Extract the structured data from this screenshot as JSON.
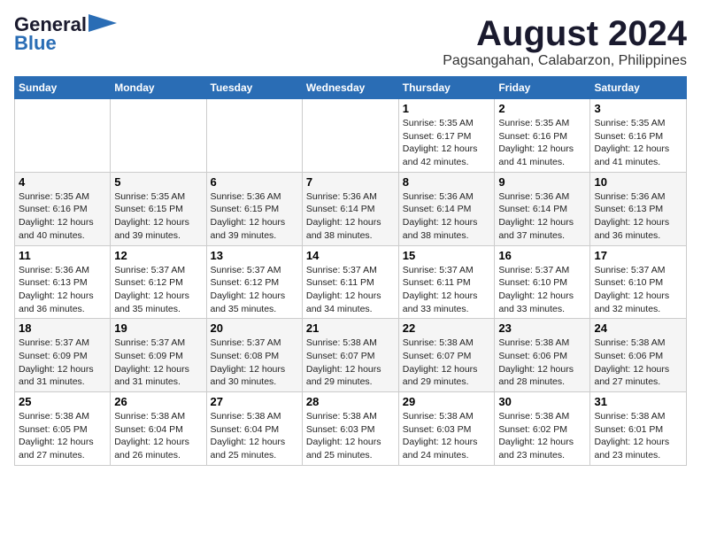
{
  "header": {
    "logo_line1": "General",
    "logo_line2": "Blue",
    "title": "August 2024",
    "subtitle": "Pagsangahan, Calabarzon, Philippines"
  },
  "weekdays": [
    "Sunday",
    "Monday",
    "Tuesday",
    "Wednesday",
    "Thursday",
    "Friday",
    "Saturday"
  ],
  "weeks": [
    [
      {
        "day": "",
        "info": ""
      },
      {
        "day": "",
        "info": ""
      },
      {
        "day": "",
        "info": ""
      },
      {
        "day": "",
        "info": ""
      },
      {
        "day": "1",
        "info": "Sunrise: 5:35 AM\nSunset: 6:17 PM\nDaylight: 12 hours\nand 42 minutes."
      },
      {
        "day": "2",
        "info": "Sunrise: 5:35 AM\nSunset: 6:16 PM\nDaylight: 12 hours\nand 41 minutes."
      },
      {
        "day": "3",
        "info": "Sunrise: 5:35 AM\nSunset: 6:16 PM\nDaylight: 12 hours\nand 41 minutes."
      }
    ],
    [
      {
        "day": "4",
        "info": "Sunrise: 5:35 AM\nSunset: 6:16 PM\nDaylight: 12 hours\nand 40 minutes."
      },
      {
        "day": "5",
        "info": "Sunrise: 5:35 AM\nSunset: 6:15 PM\nDaylight: 12 hours\nand 39 minutes."
      },
      {
        "day": "6",
        "info": "Sunrise: 5:36 AM\nSunset: 6:15 PM\nDaylight: 12 hours\nand 39 minutes."
      },
      {
        "day": "7",
        "info": "Sunrise: 5:36 AM\nSunset: 6:14 PM\nDaylight: 12 hours\nand 38 minutes."
      },
      {
        "day": "8",
        "info": "Sunrise: 5:36 AM\nSunset: 6:14 PM\nDaylight: 12 hours\nand 38 minutes."
      },
      {
        "day": "9",
        "info": "Sunrise: 5:36 AM\nSunset: 6:14 PM\nDaylight: 12 hours\nand 37 minutes."
      },
      {
        "day": "10",
        "info": "Sunrise: 5:36 AM\nSunset: 6:13 PM\nDaylight: 12 hours\nand 36 minutes."
      }
    ],
    [
      {
        "day": "11",
        "info": "Sunrise: 5:36 AM\nSunset: 6:13 PM\nDaylight: 12 hours\nand 36 minutes."
      },
      {
        "day": "12",
        "info": "Sunrise: 5:37 AM\nSunset: 6:12 PM\nDaylight: 12 hours\nand 35 minutes."
      },
      {
        "day": "13",
        "info": "Sunrise: 5:37 AM\nSunset: 6:12 PM\nDaylight: 12 hours\nand 35 minutes."
      },
      {
        "day": "14",
        "info": "Sunrise: 5:37 AM\nSunset: 6:11 PM\nDaylight: 12 hours\nand 34 minutes."
      },
      {
        "day": "15",
        "info": "Sunrise: 5:37 AM\nSunset: 6:11 PM\nDaylight: 12 hours\nand 33 minutes."
      },
      {
        "day": "16",
        "info": "Sunrise: 5:37 AM\nSunset: 6:10 PM\nDaylight: 12 hours\nand 33 minutes."
      },
      {
        "day": "17",
        "info": "Sunrise: 5:37 AM\nSunset: 6:10 PM\nDaylight: 12 hours\nand 32 minutes."
      }
    ],
    [
      {
        "day": "18",
        "info": "Sunrise: 5:37 AM\nSunset: 6:09 PM\nDaylight: 12 hours\nand 31 minutes."
      },
      {
        "day": "19",
        "info": "Sunrise: 5:37 AM\nSunset: 6:09 PM\nDaylight: 12 hours\nand 31 minutes."
      },
      {
        "day": "20",
        "info": "Sunrise: 5:37 AM\nSunset: 6:08 PM\nDaylight: 12 hours\nand 30 minutes."
      },
      {
        "day": "21",
        "info": "Sunrise: 5:38 AM\nSunset: 6:07 PM\nDaylight: 12 hours\nand 29 minutes."
      },
      {
        "day": "22",
        "info": "Sunrise: 5:38 AM\nSunset: 6:07 PM\nDaylight: 12 hours\nand 29 minutes."
      },
      {
        "day": "23",
        "info": "Sunrise: 5:38 AM\nSunset: 6:06 PM\nDaylight: 12 hours\nand 28 minutes."
      },
      {
        "day": "24",
        "info": "Sunrise: 5:38 AM\nSunset: 6:06 PM\nDaylight: 12 hours\nand 27 minutes."
      }
    ],
    [
      {
        "day": "25",
        "info": "Sunrise: 5:38 AM\nSunset: 6:05 PM\nDaylight: 12 hours\nand 27 minutes."
      },
      {
        "day": "26",
        "info": "Sunrise: 5:38 AM\nSunset: 6:04 PM\nDaylight: 12 hours\nand 26 minutes."
      },
      {
        "day": "27",
        "info": "Sunrise: 5:38 AM\nSunset: 6:04 PM\nDaylight: 12 hours\nand 25 minutes."
      },
      {
        "day": "28",
        "info": "Sunrise: 5:38 AM\nSunset: 6:03 PM\nDaylight: 12 hours\nand 25 minutes."
      },
      {
        "day": "29",
        "info": "Sunrise: 5:38 AM\nSunset: 6:03 PM\nDaylight: 12 hours\nand 24 minutes."
      },
      {
        "day": "30",
        "info": "Sunrise: 5:38 AM\nSunset: 6:02 PM\nDaylight: 12 hours\nand 23 minutes."
      },
      {
        "day": "31",
        "info": "Sunrise: 5:38 AM\nSunset: 6:01 PM\nDaylight: 12 hours\nand 23 minutes."
      }
    ]
  ]
}
